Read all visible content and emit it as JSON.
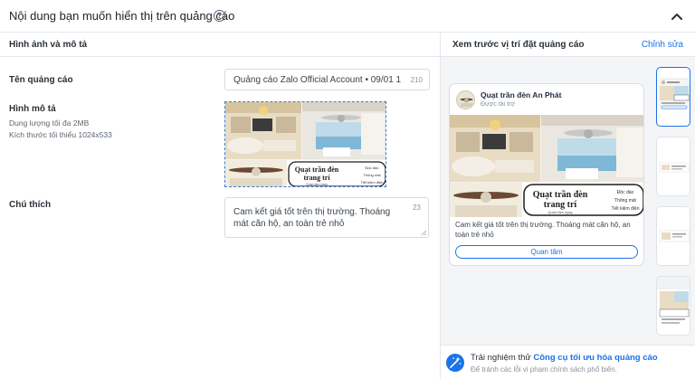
{
  "section": {
    "title": "Nội dung bạn muốn hiển thị trên quảng cáo",
    "help_icon": "question-circle-icon",
    "collapse_icon": "chevron-up-icon"
  },
  "editor": {
    "subheader": "Hình ảnh và mô tả",
    "ad_name": {
      "label": "Tên quảng cáo",
      "value": "Quảng cáo Zalo Official Account • 09/01 1",
      "char_count": "210"
    },
    "image": {
      "label": "Hình mô tả",
      "hint_size": "Dung lượng tối đa 2MB",
      "hint_dimensions": "Kích thước tối thiểu 1024x533",
      "overlay": {
        "headline_1": "Quạt trần đèn",
        "headline_2": "trang trí",
        "sub": "Quan tâm ngay",
        "features": [
          "Độc đáo",
          "Thông mát",
          "Tiết kiệm điện"
        ]
      }
    },
    "caption": {
      "label": "Chú thích",
      "value": "Cam kết giá tốt trên thị trường. Thoáng mát căn hộ, an toàn trẻ nhỏ",
      "char_count": "23"
    }
  },
  "preview": {
    "header_title": "Xem trước vị trí đặt quảng cáo",
    "edit_label": "Chỉnh sửa",
    "card": {
      "advertiser": "Quạt trần đèn An Phát",
      "sponsored": "Được tài trợ",
      "caption": "Cam kết giá tốt trên thị trường. Thoáng mát căn hộ, an toàn trẻ nhỏ",
      "cta_label": "Quan tâm"
    },
    "placements": 4
  },
  "promo": {
    "prefix": "Trải nghiệm thử ",
    "link": "Công cụ tối ưu hóa quảng cáo",
    "subtext": "Để tránh các lỗi vi phạm chính sách phổ biến."
  },
  "colors": {
    "accent": "#1a73e8",
    "border": "#e3e7ec",
    "preview_bg": "#f4f5f7"
  }
}
